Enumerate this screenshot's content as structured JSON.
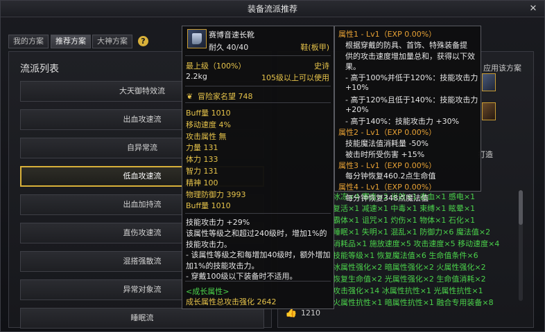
{
  "window": {
    "title": "装备流派推荐"
  },
  "tabs": [
    "我的方案",
    "推荐方案",
    "大神方案"
  ],
  "active_tab_index": 1,
  "left_panel": {
    "title": "流派列表",
    "schools": [
      "大天御特效流",
      "出血攻速流",
      "自异常流",
      "低血攻速流",
      "出血加持流",
      "直伤攻速流",
      "混搭强散流",
      "异常对象流",
      "睡眠流"
    ],
    "selected_index": 3
  },
  "right_panel": {
    "apply_label": "应用该方案",
    "forge_label": "打造",
    "like_count": "1210",
    "stats_rows": [
      "冰冻×4  寒击×2  光效×1  击血×1  感电×1",
      "复活×1  减速×1  中毒×1  束缚×1  眩晕×1",
      "霸体×1  诅咒×1  灼伤×1  物体×1  石化×1",
      "睡眠×1  失明×1  混乱×1  防御力×6  魔法值×2",
      "消耗品×1  施放速度×5  攻击速度×5  移动速度×4",
      "技能等级×1  恢复魔法值×6  生命值条件×6",
      "冰属性强化×2  暗属性强化×2  火属性强化×2",
      "恢复生命值×2  光属性强化×2  生命值消耗×2",
      "攻击强化×14  冰属性抗性×1  光属性抗性×1",
      "火属性抗性×1  暗属性抗性×1  融合专用装备×8"
    ]
  },
  "item_tooltip": {
    "name": "赛博音速长靴",
    "durability": "耐久 40/40",
    "slot": "鞋(板甲)",
    "tier": "最上级（100%）",
    "rarity": "史诗",
    "weight": "2.2kg",
    "level_req": "105级以上可以使用",
    "fame": "冒险家名望 748",
    "stats": [
      "Buff量 1010",
      "移动速度 4%",
      "攻击属性 無",
      "力量 131",
      "体力 133",
      "智力 131",
      "精神 100",
      "物理防御力 3993",
      "Buff量 1010"
    ],
    "skill_bonus": "技能攻击力 +29%",
    "desc": [
      "该属性等级之和超过240级时，增加1%的",
      "技能攻击力。",
      "- 该属性等级之和每增加40级时，额外增加",
      "加1%的技能攻击力。",
      "- 穿戴100级以下装备时不适用。"
    ],
    "growth_title": "<成长属性>",
    "growth_total": "成长属性总攻击强化 2642"
  },
  "property_tooltip": {
    "p1_title": "属性1 - Lv1（EXP 0.00%）",
    "p1_desc": [
      "根据穿戴的防具、首饰、特殊装备提",
      "供的攻击速度增加量总和，获得以下效",
      "果。"
    ],
    "p1_tiers": [
      "- 高于100%并低于120%：技能攻击力",
      "+10%",
      "- 高于120%且低于140%：技能攻击力",
      "+20%",
      "- 高于140%：技能攻击力 +30%"
    ],
    "p2_title": "属性2 - Lv1（EXP 0.00%）",
    "p2_desc": [
      "技能魔法值消耗量 -50%",
      "被击时所受伤害 +15%"
    ],
    "p3_title": "属性3 - Lv1（EXP 0.00%）",
    "p3_desc": [
      "每分钟恢复460.2点生命值"
    ],
    "p4_title": "属性4 - Lv1（EXP 0.00%）",
    "p4_desc": [
      "每分钟恢复348点魔法值"
    ]
  },
  "colors": {
    "accent": "#d9b13a",
    "stat_green": "#4bd34b",
    "prop_orange": "#e8a235"
  }
}
